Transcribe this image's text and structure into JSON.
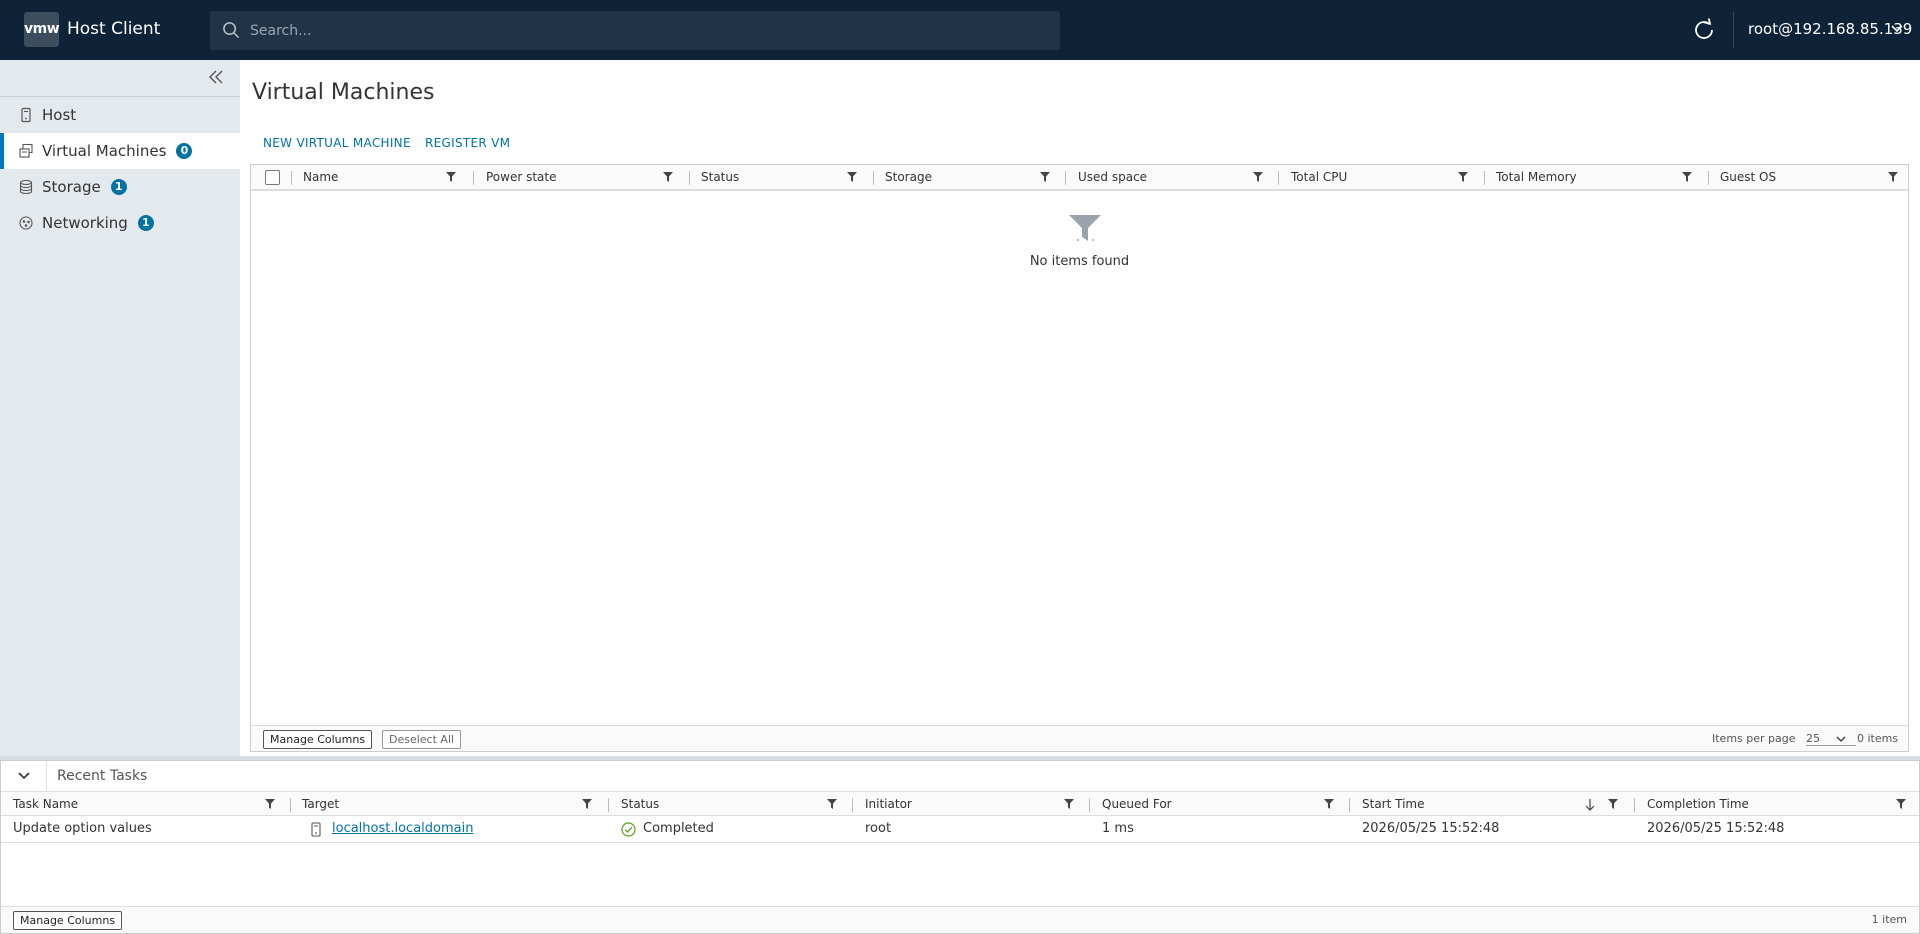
{
  "header": {
    "logo_text": "vmw",
    "app_title": "Host Client",
    "search_placeholder": "Search...",
    "user": "root@192.168.85.139"
  },
  "sidebar": {
    "items": [
      {
        "label": "Host",
        "badge": null,
        "icon": "server-icon",
        "active": false
      },
      {
        "label": "Virtual Machines",
        "badge": "0",
        "icon": "vm-icon",
        "active": true
      },
      {
        "label": "Storage",
        "badge": "1",
        "icon": "storage-icon",
        "active": false
      },
      {
        "label": "Networking",
        "badge": "1",
        "icon": "network-icon",
        "active": false
      }
    ]
  },
  "main": {
    "title": "Virtual Machines",
    "actions": [
      "NEW VIRTUAL MACHINE",
      "REGISTER VM"
    ],
    "columns": [
      "Name",
      "Power state",
      "Status",
      "Storage",
      "Used space",
      "Total CPU",
      "Total Memory",
      "Guest OS"
    ],
    "empty_text": "No items found",
    "footer": {
      "manage_columns": "Manage Columns",
      "deselect_all": "Deselect All",
      "items_per_page_label": "Items per page",
      "items_per_page": "25",
      "items_count": "0 items"
    }
  },
  "tasks": {
    "title": "Recent Tasks",
    "columns": [
      "Task Name",
      "Target",
      "Status",
      "Initiator",
      "Queued For",
      "Start Time",
      "Completion Time"
    ],
    "rows": [
      {
        "task_name": "Update option values",
        "target": "localhost.localdomain",
        "status": "Completed",
        "initiator": "root",
        "queued_for": "1 ms",
        "start_time": "2026/05/25 15:52:48",
        "completion_time": "2026/05/25 15:52:48"
      }
    ],
    "manage_columns": "Manage Columns",
    "count": "1 item"
  },
  "colors": {
    "header_bg": "#0e2337",
    "accent": "#0072a3",
    "sidebar_bg": "#e4e9ed",
    "success": "#5aa220"
  }
}
